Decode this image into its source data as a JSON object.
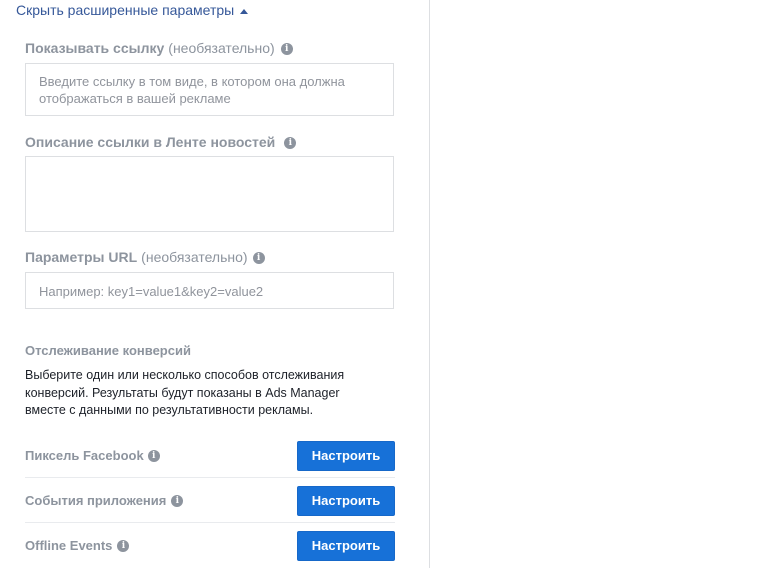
{
  "advanced_toggle": {
    "label": "Скрыть расширенные параметры",
    "icon": "caret-up-icon"
  },
  "display_link": {
    "label": "Показывать ссылку",
    "optional": "(необязательно)",
    "placeholder": "Введите ссылку в том виде, в котором она должна отображаться в вашей рекламе",
    "value": ""
  },
  "newsfeed_link_description": {
    "label": "Описание ссылки в Ленте новостей",
    "value": ""
  },
  "url_parameters": {
    "label": "Параметры URL",
    "optional": "(необязательно)",
    "placeholder": "Например: key1=value1&key2=value2",
    "value": ""
  },
  "conversion_tracking": {
    "title": "Отслеживание конверсий",
    "description": "Выберите один или несколько способов отслеживания конверсий. Результаты будут показаны в Ads Manager вместе с данными по результативности рекламы.",
    "rows": [
      {
        "label": "Пиксель Facebook",
        "button": "Настроить"
      },
      {
        "label": "События приложения",
        "button": "Настроить"
      },
      {
        "label": "Offline Events",
        "button": "Настроить"
      }
    ]
  },
  "colors": {
    "link": "#365899",
    "label_gray": "#8d949e",
    "button_blue": "#1771d8",
    "border": "#dddfe2"
  }
}
